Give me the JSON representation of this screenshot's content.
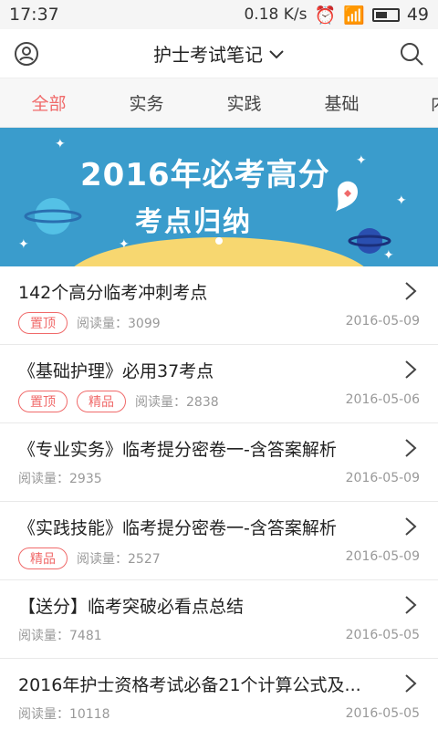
{
  "status": {
    "time": "17:37",
    "net_speed": "0.18 K/s",
    "battery": "49"
  },
  "header": {
    "title": "护士考试笔记",
    "dropdown_icon": "chevron-down-icon",
    "left_icon": "user-icon",
    "right_icon": "search-icon"
  },
  "tabs": [
    {
      "label": "全部",
      "active": true
    },
    {
      "label": "实务"
    },
    {
      "label": "实践"
    },
    {
      "label": "基础"
    },
    {
      "label": "内"
    }
  ],
  "banner": {
    "line1": "2016年必考高分",
    "line2": "考点归纳"
  },
  "items": [
    {
      "title": "142个高分临考冲刺考点",
      "badges": [
        "置顶"
      ],
      "reads_label": "阅读量：",
      "reads": "3099",
      "date": "2016-05-09"
    },
    {
      "title": "《基础护理》必用37考点",
      "badges": [
        "置顶",
        "精品"
      ],
      "reads_label": "阅读量：",
      "reads": "2838",
      "date": "2016-05-06"
    },
    {
      "title": "《专业实务》临考提分密卷一-含答案解析",
      "badges": [],
      "reads_label": "阅读量：",
      "reads": "2935",
      "date": "2016-05-09"
    },
    {
      "title": "《实践技能》临考提分密卷一-含答案解析",
      "badges": [
        "精品"
      ],
      "reads_label": "阅读量：",
      "reads": "2527",
      "date": "2016-05-09"
    },
    {
      "title": "【送分】临考突破必看点总结",
      "badges": [],
      "reads_label": "阅读量：",
      "reads": "7481",
      "date": "2016-05-05"
    },
    {
      "title": "2016年护士资格考试必备21个计算公式及...",
      "badges": [],
      "reads_label": "阅读量：",
      "reads": "10118",
      "date": "2016-05-05"
    }
  ],
  "colors": {
    "accent": "#f06a6a",
    "banner": "#3a9ccc"
  }
}
